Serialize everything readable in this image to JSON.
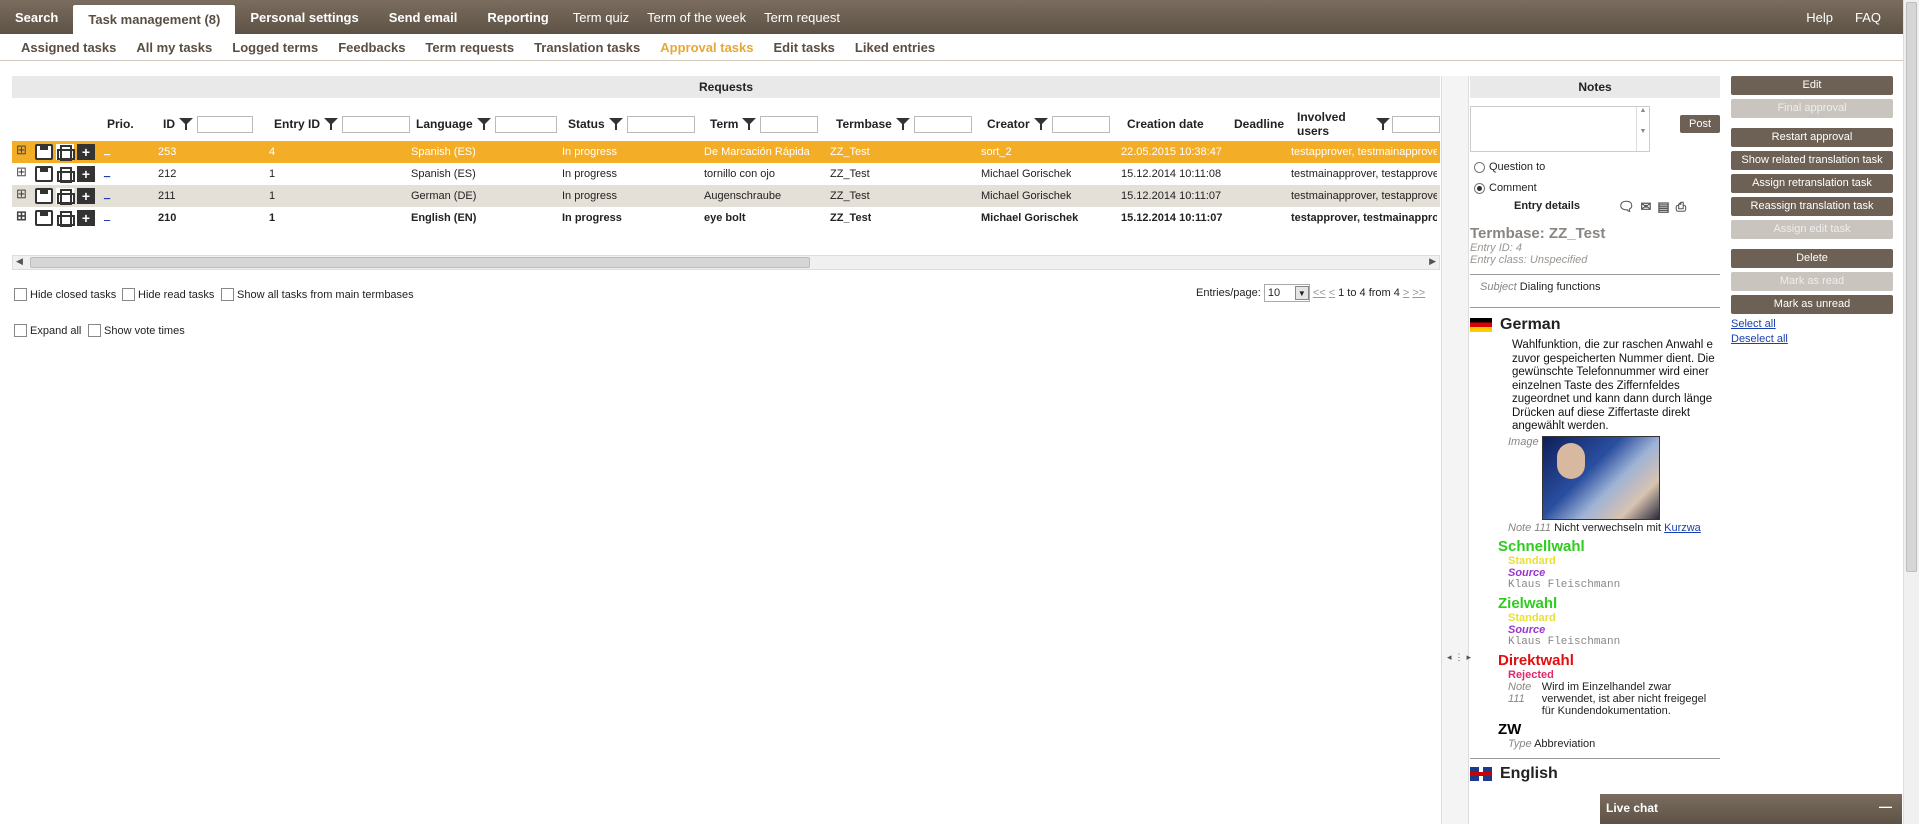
{
  "topnav": {
    "items": [
      "Search",
      "Task management (8)",
      "Personal settings",
      "Send email",
      "Reporting"
    ],
    "plain": [
      "Term quiz",
      "Term of the week",
      "Term request"
    ],
    "right": [
      "Help",
      "FAQ"
    ]
  },
  "subnav": [
    "Assigned tasks",
    "All my tasks",
    "Logged terms",
    "Feedbacks",
    "Term requests",
    "Translation tasks",
    "Approval tasks",
    "Edit tasks",
    "Liked entries"
  ],
  "requests": {
    "title": "Requests",
    "columns": [
      "Prio.",
      "ID",
      "Entry ID",
      "Language",
      "Status",
      "Term",
      "Termbase",
      "Creator",
      "Creation date",
      "Deadline",
      "Involved users"
    ],
    "prio_link": "_",
    "rows": [
      {
        "id": "253",
        "entry": "4",
        "lang": "Spanish (ES)",
        "status": "In progress",
        "term": "De Marcación Rápida",
        "tb": "ZZ_Test",
        "creator": "sort_2",
        "date": "22.05.2015 10:38:47",
        "users": "testapprover, testmainapprove"
      },
      {
        "id": "212",
        "entry": "1",
        "lang": "Spanish (ES)",
        "status": "In progress",
        "term": "tornillo con ojo",
        "tb": "ZZ_Test",
        "creator": "Michael Gorischek",
        "date": "15.12.2014 10:11:08",
        "users": "testmainapprover, testapprove"
      },
      {
        "id": "211",
        "entry": "1",
        "lang": "German (DE)",
        "status": "In progress",
        "term": "Augenschraube",
        "tb": "ZZ_Test",
        "creator": "Michael Gorischek",
        "date": "15.12.2014 10:11:07",
        "users": "testmainapprover, testapprove"
      },
      {
        "id": "210",
        "entry": "1",
        "lang": "English (EN)",
        "status": "In progress",
        "term": "eye bolt",
        "tb": "ZZ_Test",
        "creator": "Michael Gorischek",
        "date": "15.12.2014 10:11:07",
        "users": "testapprover, testmainappro"
      }
    ],
    "hide_closed": "Hide closed tasks",
    "hide_read": "Hide read tasks",
    "show_all": "Show all tasks from main termbases",
    "expand_all": "Expand all",
    "show_vote": "Show vote times",
    "entries_label": "Entries/page:",
    "entries_value": "10",
    "pager_first": "<<",
    "pager_prev": "<",
    "pager_text": "1 to 4 from 4",
    "pager_next": ">",
    "pager_last": ">>"
  },
  "notes": {
    "title": "Notes",
    "post": "Post",
    "question": "Question to",
    "comment": "Comment",
    "entry_details": "Entry details"
  },
  "detail": {
    "termbase": "Termbase: ZZ_Test",
    "entry_id": "Entry ID: 4",
    "entry_class": "Entry class: Unspecified",
    "subject_label": "Subject",
    "subject": "Dialing functions",
    "german": "German",
    "definition": "Wahlfunktion, die zur raschen Anwahl e zuvor gespeicherten Nummer dient. Die gewünschte Telefonnummer wird einer einzelnen Taste des Ziffernfeldes zugeordnet und kann dann durch länge Drücken auf diese Ziffertaste direkt angewählt werden.",
    "image_label": "Image",
    "note_label": "Note 111",
    "note_text": "Nicht verwechseln mit",
    "note_link": "Kurzwa",
    "terms": [
      {
        "name": "Schnellwahl",
        "color": "#2ecc1e",
        "status": "Standard",
        "source": "Source",
        "person": "Klaus Fleischmann"
      },
      {
        "name": "Zielwahl",
        "color": "#2ecc1e",
        "status": "Standard",
        "source": "Source",
        "person": "Klaus Fleischmann"
      }
    ],
    "direkt": "Direktwahl",
    "direkt_color": "#e01010",
    "rejected": "Rejected",
    "note2_label": "Note",
    "note2_num": "111",
    "note2_text": "Wird im Einzelhandel zwar verwendet, ist aber nicht freigegel für Kundendokumentation.",
    "zw": "ZW",
    "type_label": "Type",
    "type_value": "Abbreviation",
    "english": "English"
  },
  "buttons": [
    {
      "label": "Edit",
      "enabled": true
    },
    {
      "label": "Final approval",
      "enabled": false
    },
    {
      "label": "Restart approval",
      "enabled": true
    },
    {
      "label": "Show related translation task",
      "enabled": true
    },
    {
      "label": "Assign retranslation task",
      "enabled": true
    },
    {
      "label": "Reassign translation task",
      "enabled": true
    },
    {
      "label": "Assign edit task",
      "enabled": false
    },
    {
      "label": "Delete",
      "enabled": true
    },
    {
      "label": "Mark as read",
      "enabled": false
    },
    {
      "label": "Mark as unread",
      "enabled": true
    }
  ],
  "select_all": "Select all",
  "deselect_all": "Deselect all",
  "livechat": {
    "title": "Live chat",
    "min": "—"
  }
}
